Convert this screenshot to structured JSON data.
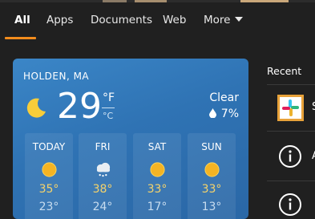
{
  "tabs": [
    {
      "label": "All",
      "active": true
    },
    {
      "label": "Apps",
      "active": false
    },
    {
      "label": "Documents",
      "active": false
    },
    {
      "label": "Web",
      "active": false
    },
    {
      "label": "More",
      "active": false,
      "icon": "chevron-down-icon"
    }
  ],
  "accent_color": "#f28c1c",
  "weather": {
    "location": "HOLDEN, MA",
    "current_icon": "moon-icon",
    "temperature": "29",
    "unit_f": "°F",
    "unit_c": "°C",
    "condition": "Clear",
    "precip_icon": "raindrop-icon",
    "precipitation": "7%",
    "forecast": [
      {
        "day": "TODAY",
        "icon": "sun-icon",
        "high": "35°",
        "low": "23°"
      },
      {
        "day": "FRI",
        "icon": "snow-cloud-icon",
        "high": "38°",
        "low": "24°"
      },
      {
        "day": "SAT",
        "icon": "sun-icon",
        "high": "33°",
        "low": "17°"
      },
      {
        "day": "SUN",
        "icon": "sun-icon",
        "high": "33°",
        "low": "13°"
      }
    ]
  },
  "recent": {
    "label": "Recent",
    "items": [
      {
        "icon": "slack-icon",
        "label_fragment": "S"
      },
      {
        "icon": "info-icon",
        "label_fragment": "A"
      },
      {
        "icon": "info-icon",
        "label_fragment": ""
      }
    ]
  }
}
